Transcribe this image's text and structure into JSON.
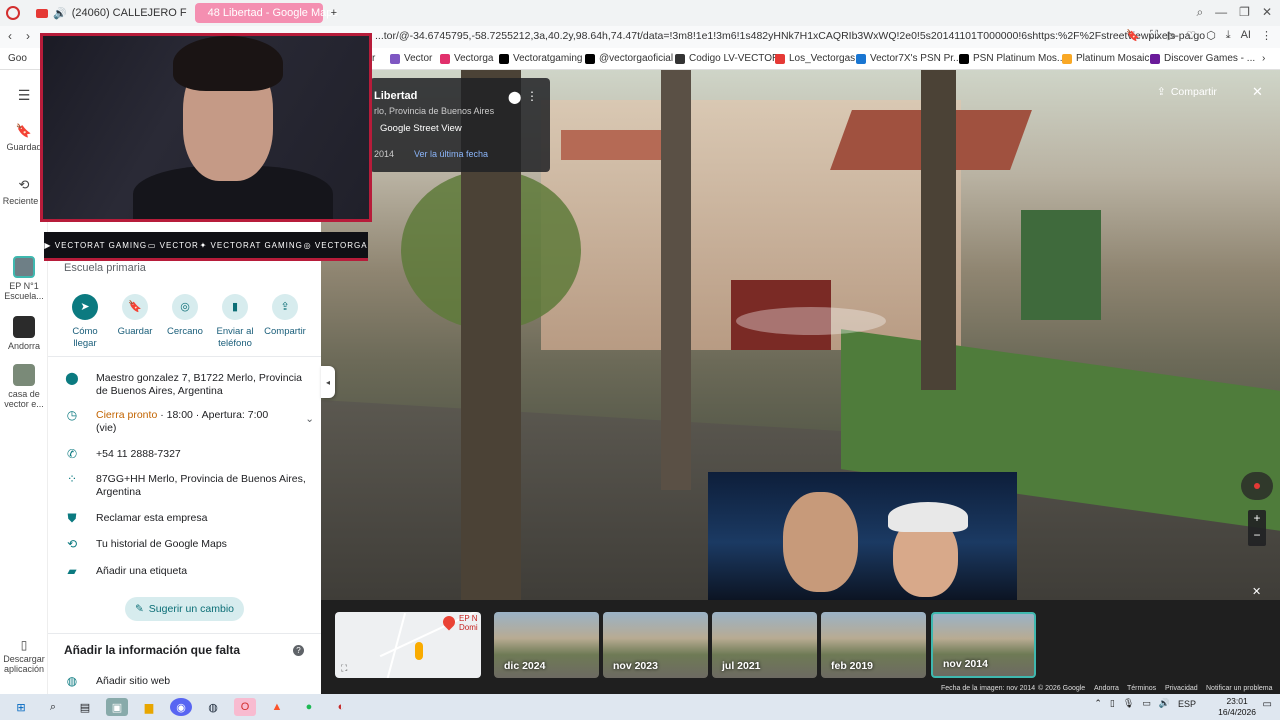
{
  "browser": {
    "tabs": [
      {
        "label": "(24060) CALLEJERO F"
      },
      {
        "label": "48 Libertad - Google Maps"
      }
    ],
    "new_tab": "+",
    "url": "...tor/@-34.6745795,-58.7255212,3a,40.2y,98.64h,74.47t/data=!3m8!1e1!3m6!1s482yHNk7H1xCAQRIb3WxWQ!2e0!5s20141101T000000!6shttps:%2F%2Fstreetviewpixels-pa.go",
    "ai_label": "AI"
  },
  "bookmarks": [
    {
      "label": "Goo",
      "color": "#4285f4"
    },
    {
      "label": "r",
      "color": "#ffffff"
    },
    {
      "label": "Vector",
      "color": "#7e57c2"
    },
    {
      "label": "Vectorga",
      "color": "#e1306c"
    },
    {
      "label": "Vectoratgaming",
      "color": "#000000"
    },
    {
      "label": "@vectorgaoficial",
      "color": "#000000"
    },
    {
      "label": "Codigo LV-VECTOR",
      "color": "#333333"
    },
    {
      "label": "Los_Vectorgas",
      "color": "#e53935"
    },
    {
      "label": "Vector7X's PSN Pr...",
      "color": "#1976d2"
    },
    {
      "label": "PSN Platinum Mos...",
      "color": "#000000"
    },
    {
      "label": "Platinum Mosaic",
      "color": "#f9a825"
    },
    {
      "label": "Discover Games - ...",
      "color": "#6a1b9a"
    }
  ],
  "rail": {
    "items": [
      {
        "label": "Guardad"
      },
      {
        "label": "Reciente s"
      },
      {
        "label": "EP N°1 Escuela..."
      },
      {
        "label": "Andorra"
      },
      {
        "label": "casa de vector e..."
      },
      {
        "label": "Descargar aplicación"
      }
    ]
  },
  "stream_overlay": {
    "socials": [
      "VECTORAT GAMING",
      "VECTOR",
      "VECTORAT GAMING",
      "VECTORGA"
    ]
  },
  "place": {
    "subtitle": "Escuela primaria",
    "actions": [
      {
        "label": "Cómo llegar",
        "icon": "directions-icon"
      },
      {
        "label": "Guardar",
        "icon": "bookmark-icon"
      },
      {
        "label": "Cercano",
        "icon": "nearby-icon"
      },
      {
        "label": "Enviar al teléfono",
        "icon": "phone-send-icon"
      },
      {
        "label": "Compartir",
        "icon": "share-icon"
      }
    ],
    "address": "Maestro gonzalez 7, B1722 Merlo, Provincia de Buenos Aires, Argentina",
    "hours_status": "Cierra pronto",
    "hours_detail": " · 18:00 · Apertura: 7:00 (vie)",
    "phone": "+54 11 2888-7327",
    "plus_code": "87GG+HH Merlo, Provincia de Buenos Aires, Argentina",
    "claim": "Reclamar esta empresa",
    "history": "Tu historial de Google Maps",
    "label_action": "Añadir una etiqueta",
    "suggest": "Sugerir un cambio",
    "add_info_title": "Añadir la información que falta",
    "add_site": "Añadir sitio web"
  },
  "streetview": {
    "title": "Libertad",
    "location": "rlo, Provincia de Buenos Aires",
    "source": "Google Street View",
    "year": "2014",
    "latest_link": "Ver la última fecha",
    "share_label": "Compartir",
    "zoom_in": "+",
    "zoom_out": "−"
  },
  "timeline": {
    "map_label": "EP N Domi",
    "thumbs": [
      {
        "label": "dic 2024"
      },
      {
        "label": "nov 2023"
      },
      {
        "label": "jul 2021"
      },
      {
        "label": "feb 2019"
      },
      {
        "label": "nov 2014"
      }
    ],
    "selected_index": 4,
    "footer": {
      "date": "Fecha de la imagen: nov 2014",
      "copyright": "© 2026 Google",
      "country": "Andorra",
      "terms": "Términos",
      "privacy": "Privacidad",
      "report": "Notificar un problema"
    }
  },
  "taskbar": {
    "lang": "ESP",
    "time": "23:01",
    "date": "16/4/2026"
  }
}
